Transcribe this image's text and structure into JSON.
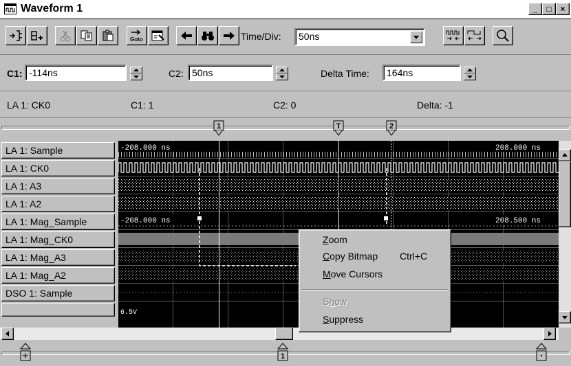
{
  "window": {
    "title": "Waveform 1",
    "min": "_",
    "max": "□",
    "close": "×"
  },
  "toolbar": {
    "time_div_label": "Time/Div:",
    "time_div_value": "50ns",
    "goto_label": "Goto"
  },
  "cursors": {
    "c1_label": "C1:",
    "c1_value": "-114ns",
    "c2_label": "C2:",
    "c2_value": "50ns",
    "delta_label": "Delta Time:",
    "delta_value": "164ns"
  },
  "info": {
    "signal": "LA 1: CK0",
    "c1": "C1: 1",
    "c2": "C2: 0",
    "delta": "Delta: -1"
  },
  "markers": {
    "m1": "1",
    "trigger": "T",
    "m2": "2"
  },
  "signals": [
    "LA 1: Sample",
    "LA 1: CK0",
    "LA 1: A3",
    "LA 1: A2",
    "LA 1: Mag_Sample",
    "LA 1: Mag_CK0",
    "LA 1: Mag_A3",
    "LA 1: Mag_A2",
    "DSO 1: Sample"
  ],
  "scope": {
    "sample_left": "-208.000 ns",
    "sample_right": "208.000 ns",
    "mag_left": "-208.000 ns",
    "mag_right": "208.500 ns",
    "dso_level": "6.5V"
  },
  "context_menu": {
    "items": [
      {
        "label": "Zoom",
        "accel": "Z",
        "shortcut": ""
      },
      {
        "label": "Copy Bitmap",
        "accel": "C",
        "shortcut": "Ctrl+C"
      },
      {
        "label": "Move Cursors",
        "accel": "M",
        "shortcut": ""
      },
      {
        "label": "Show",
        "accel": "h",
        "shortcut": "",
        "disabled": true
      },
      {
        "label": "Suppress",
        "accel": "S",
        "shortcut": ""
      }
    ]
  },
  "colors": {
    "background": "#c0c0c0",
    "scope": "#000000",
    "trace": "#ffffff",
    "grid": "#808080"
  }
}
